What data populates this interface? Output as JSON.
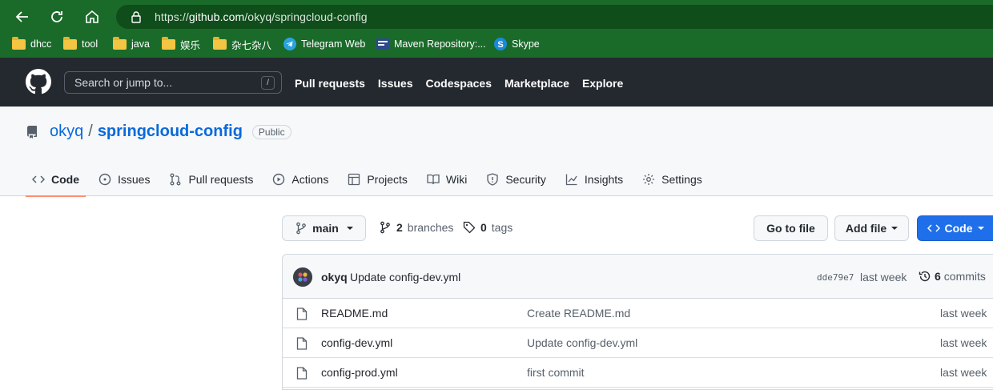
{
  "browser": {
    "url_scheme": "https://",
    "url_host": "github.com",
    "url_path": "/okyq/springcloud-config",
    "bookmarks": [
      {
        "label": "dhcc",
        "icon": "folder-icon"
      },
      {
        "label": "tool",
        "icon": "folder-icon"
      },
      {
        "label": "java",
        "icon": "folder-icon"
      },
      {
        "label": "娱乐",
        "icon": "folder-icon"
      },
      {
        "label": "杂七杂八",
        "icon": "folder-icon"
      },
      {
        "label": "Telegram Web",
        "icon": "telegram-icon"
      },
      {
        "label": "Maven Repository:...",
        "icon": "maven-icon"
      },
      {
        "label": "Skype",
        "icon": "skype-icon"
      }
    ]
  },
  "github_header": {
    "search_placeholder": "Search or jump to...",
    "search_shortcut": "/",
    "nav": [
      "Pull requests",
      "Issues",
      "Codespaces",
      "Marketplace",
      "Explore"
    ]
  },
  "repo": {
    "owner": "okyq",
    "separator": "/",
    "name": "springcloud-config",
    "visibility": "Public",
    "tabs": [
      {
        "label": "Code",
        "icon": "code-icon",
        "active": true
      },
      {
        "label": "Issues",
        "icon": "issue-icon"
      },
      {
        "label": "Pull requests",
        "icon": "pull-request-icon"
      },
      {
        "label": "Actions",
        "icon": "play-icon"
      },
      {
        "label": "Projects",
        "icon": "table-icon"
      },
      {
        "label": "Wiki",
        "icon": "book-icon"
      },
      {
        "label": "Security",
        "icon": "shield-icon"
      },
      {
        "label": "Insights",
        "icon": "graph-icon"
      },
      {
        "label": "Settings",
        "icon": "gear-icon"
      }
    ]
  },
  "toolbar": {
    "branch": "main",
    "branches_count": "2",
    "branches_label": "branches",
    "tags_count": "0",
    "tags_label": "tags",
    "go_to_file": "Go to file",
    "add_file": "Add file",
    "code": "Code"
  },
  "latest_commit": {
    "author": "okyq",
    "message": "Update config-dev.yml",
    "sha": "dde79e7",
    "time": "last week",
    "commits_count": "6",
    "commits_label": "commits"
  },
  "files": [
    {
      "name": "README.md",
      "message": "Create README.md",
      "time": "last week"
    },
    {
      "name": "config-dev.yml",
      "message": "Update config-dev.yml",
      "time": "last week"
    },
    {
      "name": "config-prod.yml",
      "message": "first commit",
      "time": "last week"
    }
  ],
  "colors": {
    "browser_green": "#1a6b2a",
    "github_header": "#24292f",
    "link_blue": "#0969da",
    "primary_button": "#1f6feb",
    "active_tab_underline": "#fd8c73"
  }
}
